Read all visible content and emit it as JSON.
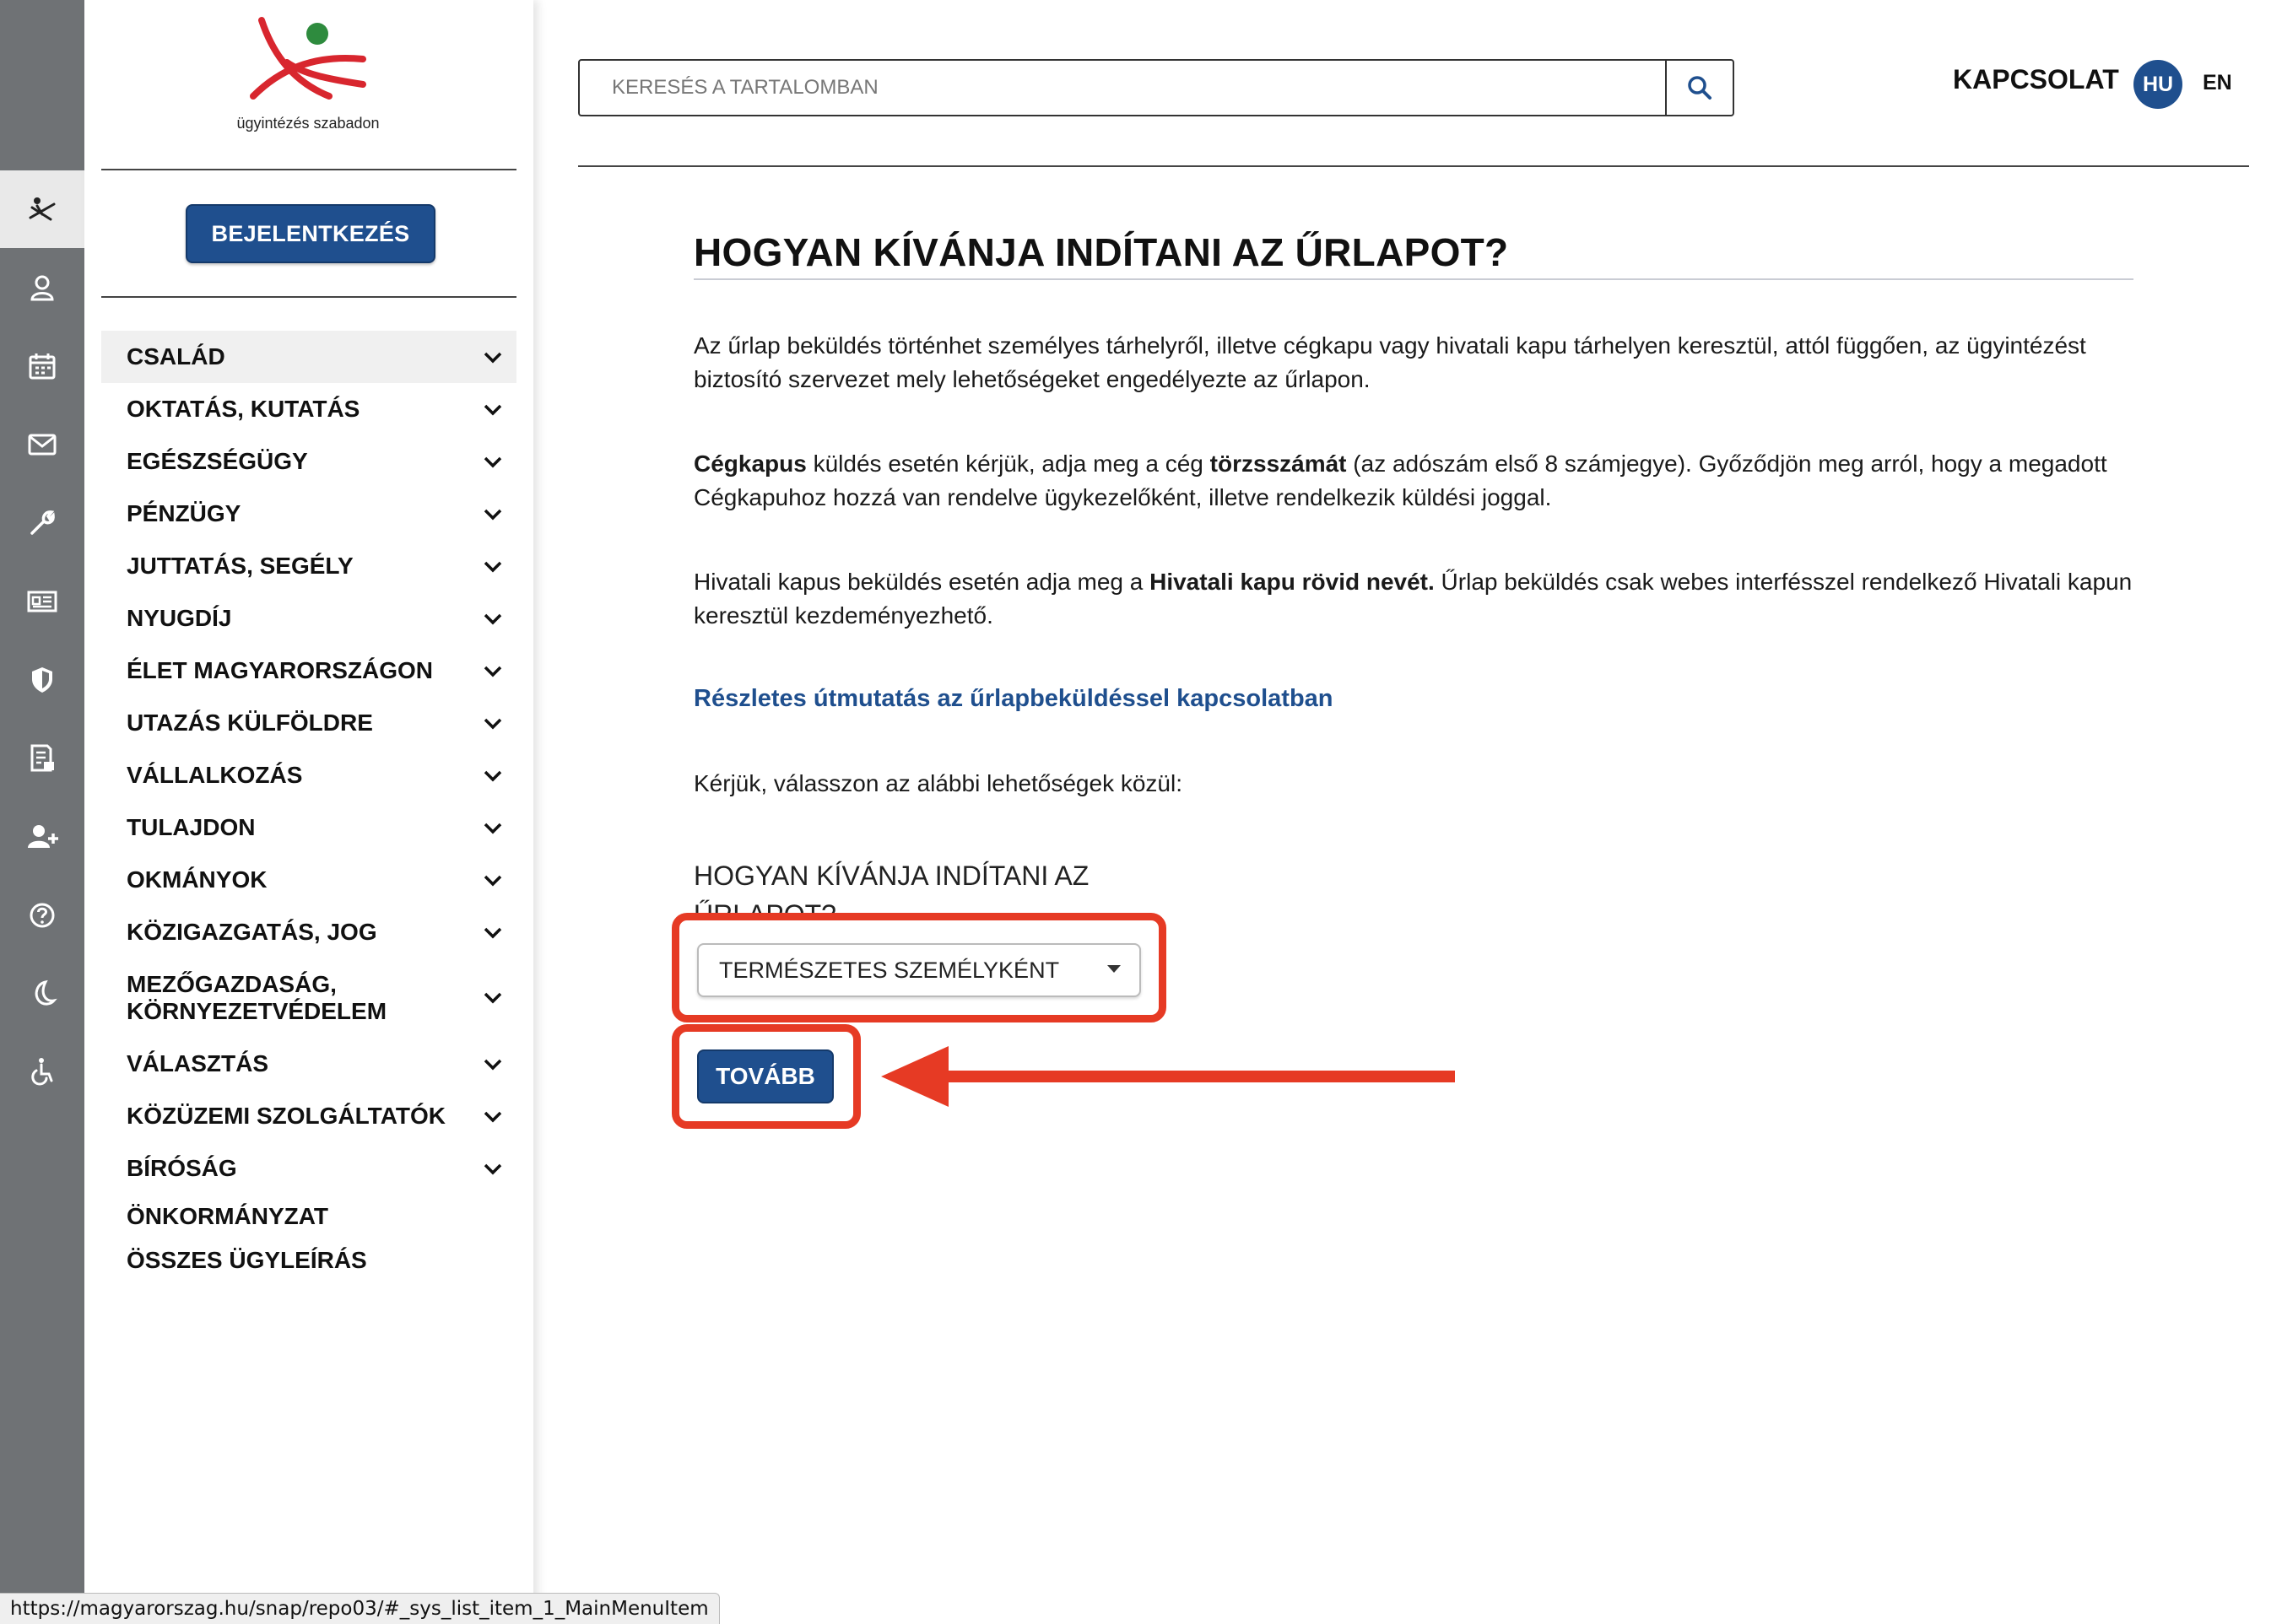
{
  "logo": {
    "caption": "ügyintézés szabadon"
  },
  "rail": {
    "icons": [
      "person-on-cross-icon",
      "user-icon",
      "calendar-icon",
      "mail-icon",
      "wrench-icon",
      "newspaper-icon",
      "shield-icon",
      "document-lock-icon",
      "add-user-icon",
      "help-icon",
      "moon-icon",
      "accessibility-icon"
    ]
  },
  "sidebar": {
    "login_label": "BEJELENTKEZÉS",
    "menu": [
      {
        "label": "CSALÁD"
      },
      {
        "label": "OKTATÁS, KUTATÁS"
      },
      {
        "label": "EGÉSZSÉGÜGY"
      },
      {
        "label": "PÉNZÜGY"
      },
      {
        "label": "JUTTATÁS, SEGÉLY"
      },
      {
        "label": "NYUGDÍJ"
      },
      {
        "label": "ÉLET MAGYARORSZÁGON"
      },
      {
        "label": "UTAZÁS KÜLFÖLDRE"
      },
      {
        "label": "VÁLLALKOZÁS"
      },
      {
        "label": "TULAJDON"
      },
      {
        "label": "OKMÁNYOK"
      },
      {
        "label": "KÖZIGAZGATÁS, JOG"
      },
      {
        "label": "MEZŐGAZDASÁG, KÖRNYEZETVÉDELEM"
      },
      {
        "label": "VÁLASZTÁS"
      },
      {
        "label": "KÖZÜZEMI SZOLGÁLTATÓK"
      },
      {
        "label": "BÍRÓSÁG"
      },
      {
        "label": "ÖNKORMÁNYZAT"
      },
      {
        "label": "ÖSSZES ÜGYLEÍRÁS"
      }
    ]
  },
  "header": {
    "search_placeholder": "KERESÉS A TARTALOMBAN",
    "contact_label": "KAPCSOLAT",
    "lang_active": "HU",
    "lang_other": "EN"
  },
  "main": {
    "title": "HOGYAN KÍVÁNJA INDÍTANI AZ ŰRLAPOT?",
    "para1": "Az űrlap beküldés történhet személyes tárhelyről, illetve cégkapu vagy hivatali kapu tárhelyen keresztül, attól függően, az ügyintézést biztosító szervezet mely lehetőségeket engedélyezte az űrlapon.",
    "para2": {
      "b1": "Cégkapus",
      "t1": " küldés esetén kérjük, adja meg a cég ",
      "b2": "törzsszámát",
      "t2": " (az adószám első 8 számjegye). Győződjön meg arról, hogy a megadott Cégkapuhoz hozzá van rendelve ügykezelőként, illetve rendelkezik küldési joggal."
    },
    "para3": {
      "t1": "Hivatali kapus beküldés esetén adja meg a ",
      "b1": "Hivatali kapu rövid nevét.",
      "t2": " Űrlap beküldés csak webes interfésszel rendelkező Hivatali kapun keresztül kezdeményezhető."
    },
    "guide_link": "Részletes útmutatás az űrlapbeküldéssel kapcsolatban",
    "choose_text": "Kérjük, válasszon az alábbi lehetőségek közül:",
    "select_label": "HOGYAN KÍVÁNJA INDÍTANI AZ ŰRLAPOT?",
    "select_value": "TERMÉSZETES SZEMÉLYKÉNT",
    "next_label": "TOVÁBB"
  },
  "annotation": {
    "color": "#e63a24"
  },
  "statusbar": {
    "url": "https://magyarorszag.hu/snap/repo03/#_sys_list_item_1_MainMenuItem"
  },
  "colors": {
    "brand_blue": "#1f4f8e",
    "rail_gray": "#6f7275",
    "logo_red": "#d8262e",
    "logo_green": "#2e8b3e"
  }
}
